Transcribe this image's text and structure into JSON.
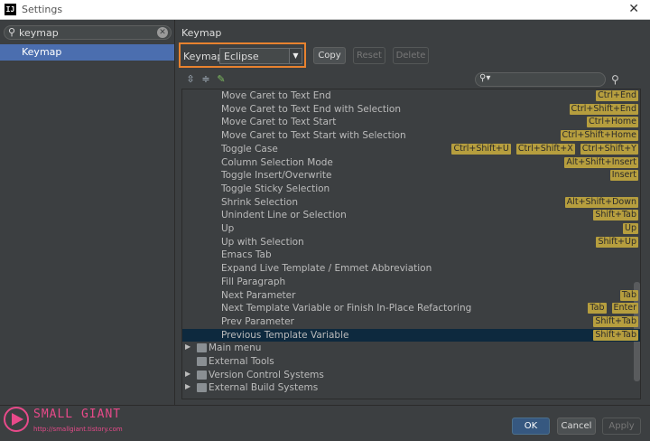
{
  "window": {
    "title": "Settings",
    "app_icon_text": "IJ",
    "close_glyph": "✕"
  },
  "sidebar": {
    "search_value": "keymap",
    "items": [
      {
        "label": "Keymap",
        "selected": true
      }
    ]
  },
  "main": {
    "title": "Keymap",
    "keymaps_label": "Keymaps:",
    "keymap_selected": "Eclipse",
    "buttons": {
      "copy": "Copy",
      "reset": "Reset",
      "delete": "Delete"
    },
    "actions": [
      {
        "name": "Move Caret to Text End",
        "shortcuts": [
          "Ctrl+End"
        ]
      },
      {
        "name": "Move Caret to Text End with Selection",
        "shortcuts": [
          "Ctrl+Shift+End"
        ]
      },
      {
        "name": "Move Caret to Text Start",
        "shortcuts": [
          "Ctrl+Home"
        ]
      },
      {
        "name": "Move Caret to Text Start with Selection",
        "shortcuts": [
          "Ctrl+Shift+Home"
        ]
      },
      {
        "name": "Toggle Case",
        "shortcuts": [
          "Ctrl+Shift+U",
          "Ctrl+Shift+X",
          "Ctrl+Shift+Y"
        ]
      },
      {
        "name": "Column Selection Mode",
        "shortcuts": [
          "Alt+Shift+Insert"
        ]
      },
      {
        "name": "Toggle Insert/Overwrite",
        "shortcuts": [
          "Insert"
        ]
      },
      {
        "name": "Toggle Sticky Selection",
        "shortcuts": []
      },
      {
        "name": "Shrink Selection",
        "shortcuts": [
          "Alt+Shift+Down"
        ]
      },
      {
        "name": "Unindent Line or Selection",
        "shortcuts": [
          "Shift+Tab"
        ]
      },
      {
        "name": "Up",
        "shortcuts": [
          "Up"
        ]
      },
      {
        "name": "Up with Selection",
        "shortcuts": [
          "Shift+Up"
        ]
      },
      {
        "name": "Emacs Tab",
        "shortcuts": []
      },
      {
        "name": "Expand Live Template / Emmet Abbreviation",
        "shortcuts": []
      },
      {
        "name": "Fill Paragraph",
        "shortcuts": []
      },
      {
        "name": "Next Parameter",
        "shortcuts": [
          "Tab"
        ]
      },
      {
        "name": "Next Template Variable or Finish In-Place Refactoring",
        "shortcuts": [
          "Tab",
          "Enter"
        ]
      },
      {
        "name": "Prev Parameter",
        "shortcuts": [
          "Shift+Tab"
        ]
      },
      {
        "name": "Previous Template Variable",
        "shortcuts": [
          "Shift+Tab"
        ],
        "selected": true
      }
    ],
    "groups": [
      {
        "name": "Main menu",
        "expandable": true
      },
      {
        "name": "External Tools",
        "expandable": false
      },
      {
        "name": "Version Control Systems",
        "expandable": true
      },
      {
        "name": "External Build Systems",
        "expandable": true
      }
    ]
  },
  "footer": {
    "brand": "SMALL GIANT",
    "brand_url": "http://smallgiant.tistory.com",
    "ok": "OK",
    "cancel": "Cancel",
    "apply": "Apply"
  },
  "colors": {
    "accent": "#4b6eaf",
    "highlight_border": "#e8822f",
    "shortcut_bg": "#b69e3e",
    "selected_row": "#0d293e",
    "brand": "#e84a8a"
  },
  "icons": [
    "app-icon",
    "search-icon",
    "clear-icon",
    "expand-all-icon",
    "collapse-all-icon",
    "edit-icon",
    "filter-search-icon",
    "find-shortcut-icon",
    "folder-icon",
    "logo-icon"
  ]
}
